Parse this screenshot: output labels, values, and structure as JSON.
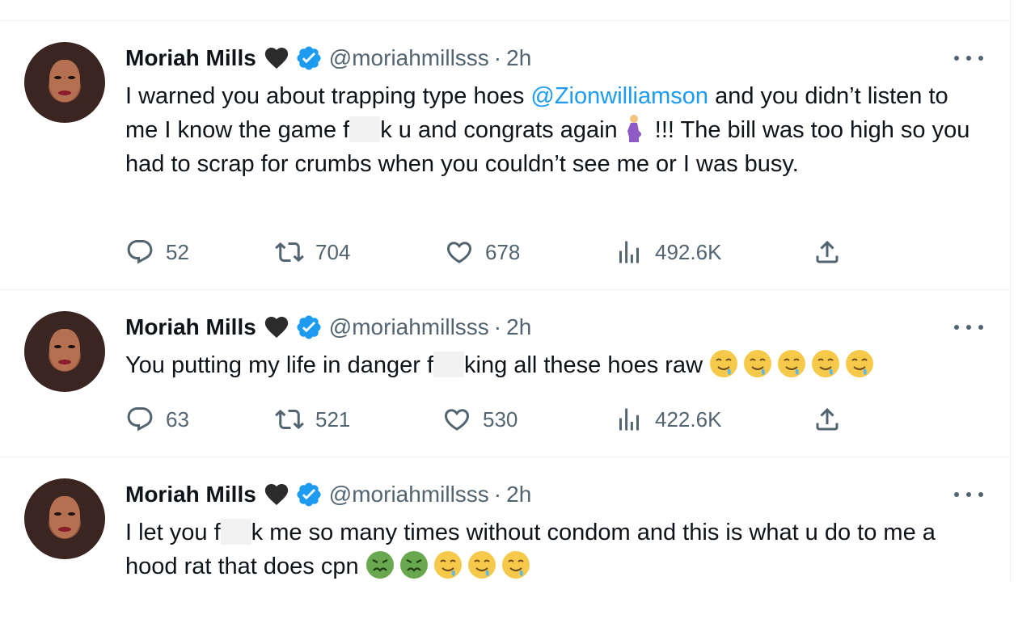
{
  "tweets": [
    {
      "author_name": "Moriah Mills",
      "handle": "@moriahmillsss",
      "separator": "·",
      "time": "2h",
      "text_before_mention": "I warned you about trapping type hoes ",
      "mention": "@Zionwilliamson",
      "text_after_mention": " and you didn’t listen to me I know the game f",
      "text_after_censor": "k u and congrats again ",
      "text_after_emoji": " !!! The bill was too high so you had to scrap for crumbs when you couldn’t see me or I was busy.",
      "replies": "52",
      "retweets": "704",
      "likes": "678",
      "views": "492.6K"
    },
    {
      "author_name": "Moriah Mills",
      "handle": "@moriahmillsss",
      "separator": "·",
      "time": "2h",
      "text_before_censor": "You putting my life in danger f",
      "text_after_censor": "king all these hoes raw ",
      "replies": "63",
      "retweets": "521",
      "likes": "530",
      "views": "422.6K"
    },
    {
      "author_name": "Moriah Mills",
      "handle": "@moriahmillsss",
      "separator": "·",
      "time": "2h",
      "text_before_censor": "I let you f",
      "text_after_censor": "k me so many times without condom and this is what u do to me a hood rat that does cpn ",
      "replies": "",
      "retweets": "",
      "likes": "",
      "views": ""
    }
  ],
  "icons": {
    "heart": "black-heart-icon",
    "verified": "verified-badge-icon",
    "more": "more-icon",
    "reply": "reply-icon",
    "retweet": "retweet-icon",
    "like": "like-icon",
    "views": "views-icon",
    "share": "share-icon",
    "emoji_pregnant": "pregnant-woman-emoji",
    "emoji_drool": "drooling-face-emoji",
    "emoji_sick": "nauseated-face-emoji"
  },
  "colors": {
    "text": "#0f1419",
    "secondary": "#536471",
    "link": "#1d9bf0",
    "verified": "#1d9bf0",
    "border": "#eff3f4"
  }
}
